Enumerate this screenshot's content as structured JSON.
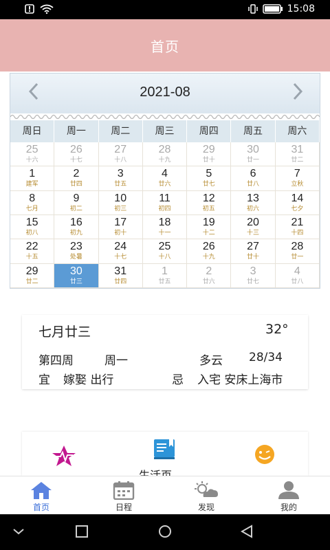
{
  "status_bar": {
    "time": "15:08"
  },
  "header": {
    "title": "首页"
  },
  "calendar": {
    "month_label": "2021-08",
    "weekdays": [
      "周日",
      "周一",
      "周二",
      "周三",
      "周四",
      "周五",
      "周六"
    ],
    "selected_day": "30",
    "days": [
      {
        "d": "25",
        "l": "十六",
        "other": true
      },
      {
        "d": "26",
        "l": "十七",
        "other": true
      },
      {
        "d": "27",
        "l": "十八",
        "other": true
      },
      {
        "d": "28",
        "l": "十九",
        "other": true
      },
      {
        "d": "29",
        "l": "廿十",
        "other": true
      },
      {
        "d": "30",
        "l": "廿一",
        "other": true
      },
      {
        "d": "31",
        "l": "廿二",
        "other": true
      },
      {
        "d": "1",
        "l": "建军"
      },
      {
        "d": "2",
        "l": "廿四"
      },
      {
        "d": "3",
        "l": "廿五"
      },
      {
        "d": "4",
        "l": "廿六"
      },
      {
        "d": "5",
        "l": "廿七"
      },
      {
        "d": "6",
        "l": "廿八"
      },
      {
        "d": "7",
        "l": "立秋"
      },
      {
        "d": "8",
        "l": "七月"
      },
      {
        "d": "9",
        "l": "初二"
      },
      {
        "d": "10",
        "l": "初三"
      },
      {
        "d": "11",
        "l": "初四"
      },
      {
        "d": "12",
        "l": "初五"
      },
      {
        "d": "13",
        "l": "初六"
      },
      {
        "d": "14",
        "l": "七夕"
      },
      {
        "d": "15",
        "l": "初八"
      },
      {
        "d": "16",
        "l": "初九"
      },
      {
        "d": "17",
        "l": "初十"
      },
      {
        "d": "18",
        "l": "十一"
      },
      {
        "d": "19",
        "l": "十二"
      },
      {
        "d": "20",
        "l": "十三"
      },
      {
        "d": "21",
        "l": "十四"
      },
      {
        "d": "22",
        "l": "十五"
      },
      {
        "d": "23",
        "l": "处暑"
      },
      {
        "d": "24",
        "l": "十七"
      },
      {
        "d": "25",
        "l": "十八"
      },
      {
        "d": "26",
        "l": "十九"
      },
      {
        "d": "27",
        "l": "廿十"
      },
      {
        "d": "28",
        "l": "廿一"
      },
      {
        "d": "29",
        "l": "廿二"
      },
      {
        "d": "30",
        "l": "廿三",
        "selected": true
      },
      {
        "d": "31",
        "l": "廿四"
      },
      {
        "d": "1",
        "l": "廿五",
        "other": true
      },
      {
        "d": "2",
        "l": "廿六",
        "other": true
      },
      {
        "d": "3",
        "l": "廿七",
        "other": true
      },
      {
        "d": "4",
        "l": "廿八",
        "other": true
      }
    ]
  },
  "info": {
    "lunar_date": "七月廿三",
    "temperature": "32°",
    "week": "第四周",
    "weekday": "周一",
    "weather": "多云",
    "temp_range": "28/34",
    "yi_label": "宜",
    "yi_items": "嫁娶  出行",
    "ji_label": "忌",
    "ji_items": "入宅  安床上海市"
  },
  "features": {
    "life_label": "生活页"
  },
  "bottom_nav": [
    {
      "label": "首页",
      "icon": "home-icon",
      "active": true
    },
    {
      "label": "日程",
      "icon": "calendar-icon"
    },
    {
      "label": "发现",
      "icon": "weather-icon"
    },
    {
      "label": "我的",
      "icon": "user-icon"
    }
  ],
  "colors": {
    "header_bg": "#e8b3b1",
    "selected_day_bg": "#5b9bd5",
    "nav_active": "#3a6ed8",
    "yi": "#5cb85c",
    "ji": "#c0392b"
  }
}
